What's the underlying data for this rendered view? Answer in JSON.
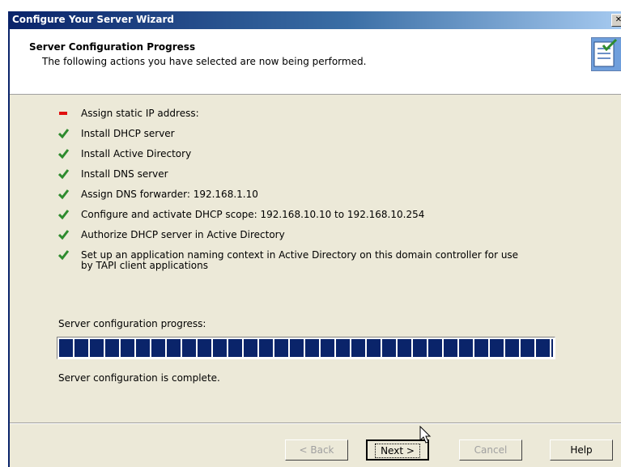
{
  "window": {
    "title": "Configure Your Server Wizard",
    "close_glyph": "✕"
  },
  "header": {
    "title": "Server Configuration Progress",
    "subtitle": "The following actions you have selected are now being performed.",
    "icon": "wizard-checklist-icon"
  },
  "tasks": [
    {
      "status": "pending",
      "icon": "red-dash-icon",
      "label": "Assign static IP address:"
    },
    {
      "status": "done",
      "icon": "green-check-icon",
      "label": "Install DHCP server"
    },
    {
      "status": "done",
      "icon": "green-check-icon",
      "label": "Install Active Directory"
    },
    {
      "status": "done",
      "icon": "green-check-icon",
      "label": "Install DNS server"
    },
    {
      "status": "done",
      "icon": "green-check-icon",
      "label": "Assign DNS forwarder: 192.168.1.10"
    },
    {
      "status": "done",
      "icon": "green-check-icon",
      "label": "Configure and activate DHCP scope: 192.168.10.10 to 192.168.10.254"
    },
    {
      "status": "done",
      "icon": "green-check-icon",
      "label": "Authorize DHCP server in Active Directory"
    },
    {
      "status": "done",
      "icon": "green-check-icon",
      "label": "Set up an application naming context in Active Directory on this domain controller for use",
      "label_line2": "by TAPI client applications"
    }
  ],
  "progress": {
    "label": "Server configuration progress:",
    "fraction": 1.0,
    "status_text": "Server configuration is complete."
  },
  "buttons": {
    "back": "< Back",
    "next": "Next >",
    "cancel": "Cancel",
    "help": "Help"
  },
  "colors": {
    "accent": "#0a246a",
    "check": "#2e8b2e",
    "dash": "#e01010",
    "face": "#ece9d8"
  }
}
